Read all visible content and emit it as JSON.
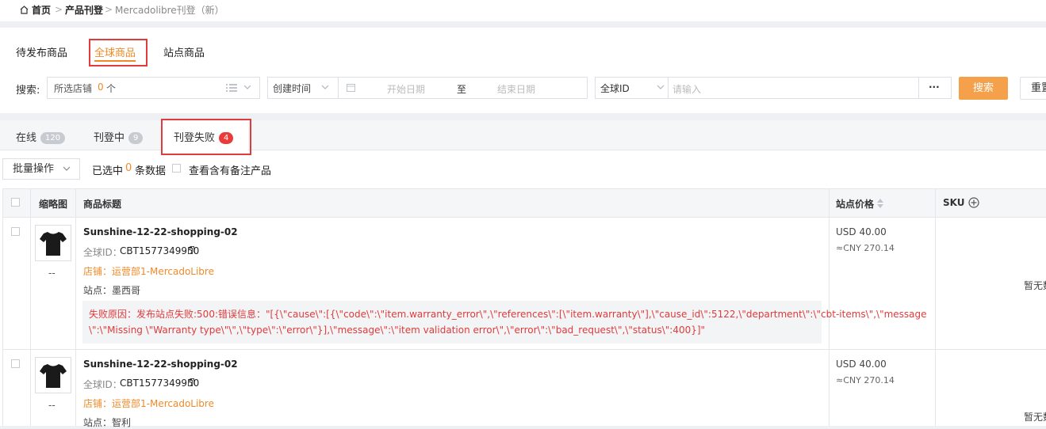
{
  "breadcrumb": {
    "home": "首页",
    "section": "产品刊登",
    "current": "Mercadolibre刊登（新）"
  },
  "main_tabs": [
    "待发布商品",
    "全球商品",
    "站点商品"
  ],
  "search": {
    "label": "搜索:",
    "store_text": "所选店铺",
    "store_count": "0",
    "store_unit": "个",
    "time_select": "创建时间",
    "start_placeholder": "开始日期",
    "to": "至",
    "end_placeholder": "结束日期",
    "id_select": "全球ID",
    "input_placeholder": "请输入",
    "more": "···",
    "search_button": "搜索",
    "reset_button": "重置"
  },
  "sub_tabs": [
    {
      "label": "在线",
      "count": "120"
    },
    {
      "label": "刊登中",
      "count": "9"
    },
    {
      "label": "刊登失败",
      "count": "4"
    }
  ],
  "toolbar": {
    "batch": "批量操作",
    "selected_prefix": "已选中",
    "selected_count": "0",
    "selected_suffix": "条数据",
    "remark_filter": "查看含有备注产品"
  },
  "table": {
    "headers": {
      "thumb": "缩略图",
      "title": "商品标题",
      "price": "站点价格",
      "sku": "SKU"
    },
    "rows": [
      {
        "title": "Sunshine-12-22-shopping-02",
        "global_id_label": "全球ID：",
        "global_id": "CBT1577349950",
        "store": "店铺：运营部1-MercadoLibre",
        "site": "站点：墨西哥",
        "thumb_note": "--",
        "error_line1": "失败原因：发布站点失败:500:错误信息：\"[{\\\"cause\\\":[{\\\"code\\\":\\\"item.warranty_error\\\",\\\"references\\\":[\\\"item.warranty\\\"],\\\"cause_id\\\":5122,\\\"department\\\":\\\"cbt-items\\\",\\\"message",
        "error_line2": "\\\":\\\"Missing \\\"Warranty type\\\"\\\",\\\"type\\\":\\\"error\\\"}],\\\"message\\\":\\\"item validation error\\\",\\\"error\\\":\\\"bad_request\\\",\\\"status\\\":400}]\"",
        "price_usd": "USD 40.00",
        "price_cny": "≈CNY 270.14",
        "sku_note": "暂无数"
      },
      {
        "title": "Sunshine-12-22-shopping-02",
        "global_id_label": "全球ID：",
        "global_id": "CBT1577349950",
        "store": "店铺：运营部1-MercadoLibre",
        "site": "站点：智利",
        "thumb_note": "--",
        "price_usd": "USD 40.00",
        "price_cny": "≈CNY 270.14",
        "sku_note": "暂无数"
      }
    ]
  },
  "colors": {
    "accent": "#ef8a28",
    "highlight_box": "#e23b3b",
    "error_text": "#e03a3a",
    "search_button": "#f5a04a"
  }
}
